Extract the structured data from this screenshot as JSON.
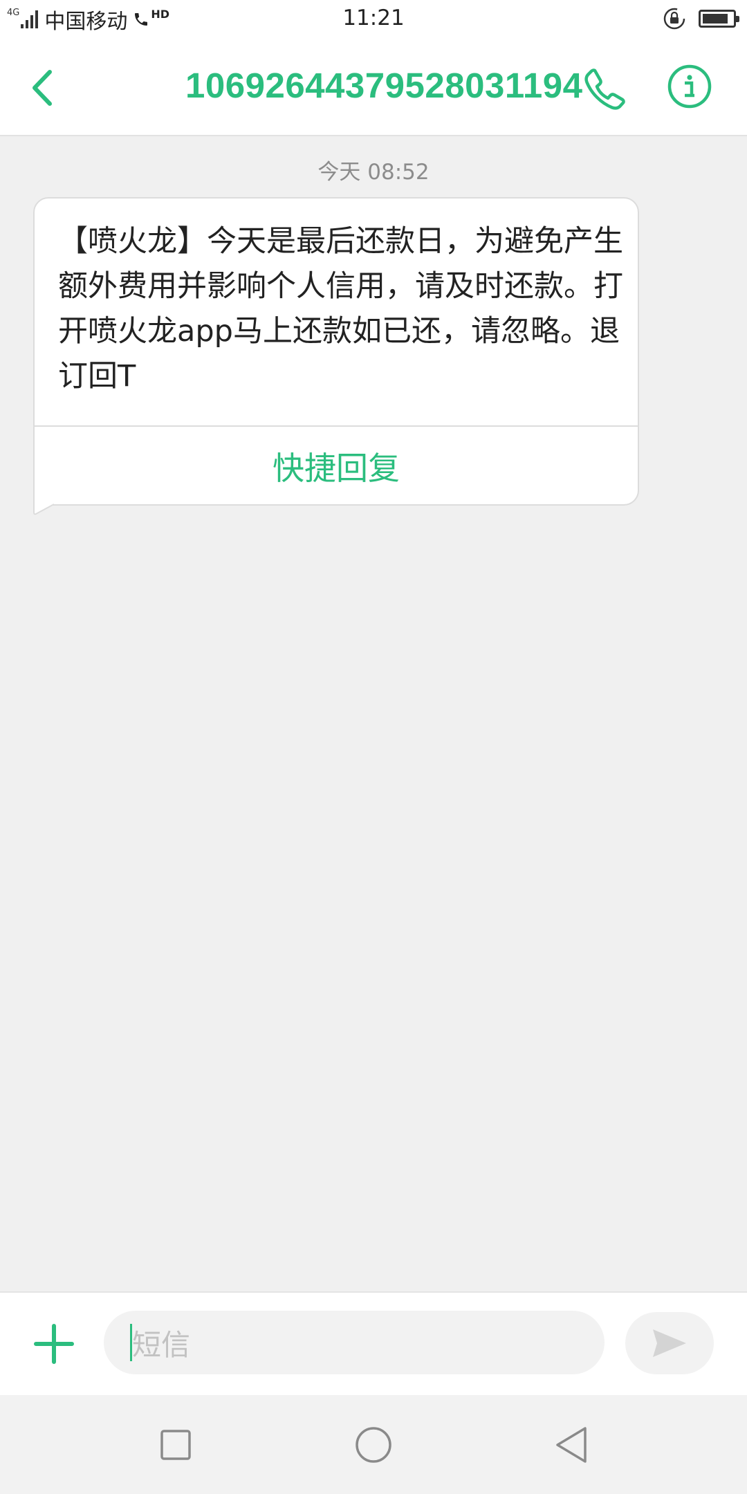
{
  "status_bar": {
    "network": "4G",
    "carrier": "中国移动",
    "volte": "HD",
    "time": "11:21",
    "battery_level": 0.85,
    "icons": [
      "signal-icon",
      "phone-hd-icon",
      "rotation-lock-icon",
      "battery-icon"
    ]
  },
  "header": {
    "title": "10692644379528031194",
    "back_icon": "chevron-left-icon",
    "call_icon": "phone-icon",
    "info_icon": "info-icon"
  },
  "conversation": {
    "timestamp": "今天 08:52",
    "messages": [
      {
        "text": "【喷火龙】今天是最后还款日，为避免产生额外费用并影响个人信用，请及时还款。打开喷火龙app马上还款如已还，请忽略。退订回T",
        "action": "快捷回复"
      }
    ]
  },
  "composer": {
    "placeholder": "短信",
    "add_icon": "plus-icon",
    "send_icon": "send-icon"
  },
  "navbar": {
    "icons": [
      "square-recents-icon",
      "circle-home-icon",
      "triangle-back-icon"
    ]
  },
  "colors": {
    "accent": "#2bbd7e",
    "background": "#f0f0f0",
    "bubble": "#ffffff"
  }
}
